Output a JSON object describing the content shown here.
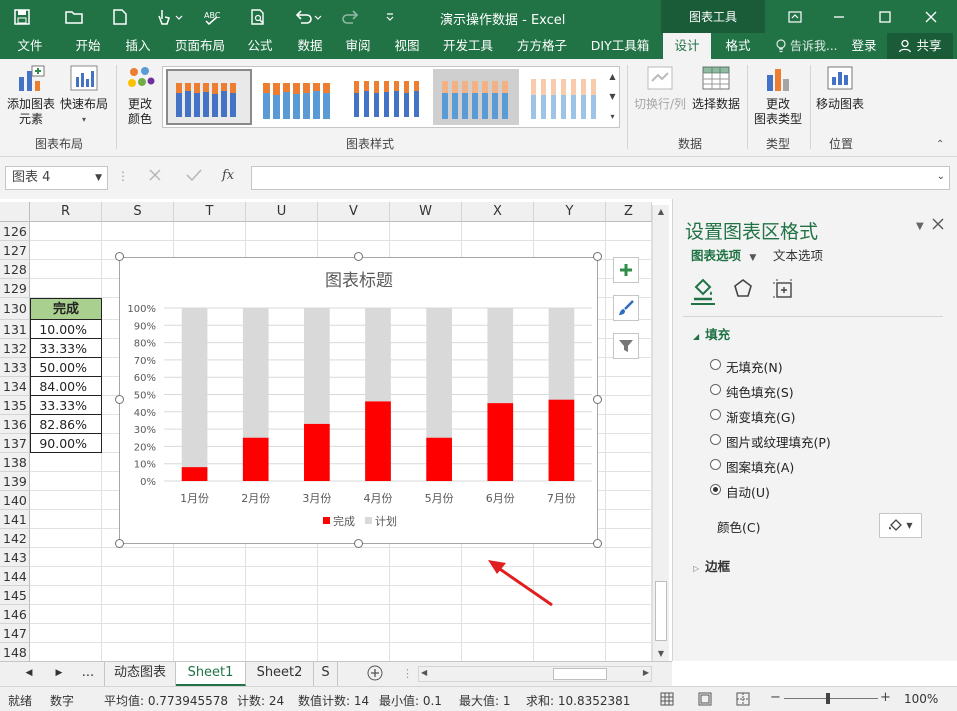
{
  "window": {
    "doc_title": "演示操作数据 - Excel",
    "context_tab_title": "图表工具"
  },
  "tabs": [
    "文件",
    "开始",
    "插入",
    "页面布局",
    "公式",
    "数据",
    "审阅",
    "视图",
    "开发工具",
    "方方格子",
    "DIY工具箱",
    "设计",
    "格式"
  ],
  "active_tab": "设计",
  "tell_me": "告诉我...",
  "login": "登录",
  "share": "共享",
  "ribbon": {
    "add_element": "添加图表\n元素",
    "quick_layout": "快速布局",
    "change_colors": "更改\n颜色",
    "group_layout": "图表布局",
    "group_styles": "图表样式",
    "switch_rowcol": "切换行/列",
    "select_data": "选择数据",
    "group_data": "数据",
    "change_type": "更改\n图表类型",
    "group_type": "类型",
    "move_chart": "移动图表",
    "group_location": "位置"
  },
  "formula": {
    "name_box": "图表 4",
    "fx": "fx"
  },
  "grid": {
    "columns": [
      "R",
      "S",
      "T",
      "U",
      "V",
      "W",
      "X",
      "Y",
      "Z"
    ],
    "rows": [
      "126",
      "127",
      "128",
      "129",
      "130",
      "131",
      "132",
      "133",
      "134",
      "135",
      "136",
      "137",
      "138",
      "139",
      "140",
      "141",
      "142",
      "143",
      "144",
      "145",
      "146",
      "147",
      "148"
    ],
    "table_header": "完成",
    "values": [
      "10.00%",
      "33.33%",
      "50.00%",
      "84.00%",
      "33.33%",
      "82.86%",
      "90.00%"
    ]
  },
  "chart_data": {
    "type": "bar",
    "title": "图表标题",
    "categories": [
      "1月份",
      "2月份",
      "3月份",
      "4月份",
      "5月份",
      "6月份",
      "7月份"
    ],
    "series": [
      {
        "name": "完成",
        "values": [
          8,
          25,
          33,
          46,
          25,
          45,
          47
        ],
        "color": "#ff0000"
      },
      {
        "name": "计划",
        "values": [
          100,
          100,
          100,
          100,
          100,
          100,
          100
        ],
        "color": "#d9d9d9"
      }
    ],
    "yticks": [
      "0%",
      "10%",
      "20%",
      "30%",
      "40%",
      "50%",
      "60%",
      "70%",
      "80%",
      "90%",
      "100%"
    ],
    "ylim": [
      0,
      100
    ],
    "grid": true,
    "legend": "bottom"
  },
  "pane": {
    "title": "设置图表区格式",
    "tab_chart_options": "图表选项",
    "tab_text_options": "文本选项",
    "section_fill": "填充",
    "fill_options": [
      "无填充(N)",
      "纯色填充(S)",
      "渐变填充(G)",
      "图片或纹理填充(P)",
      "图案填充(A)",
      "自动(U)"
    ],
    "selected_fill": "自动(U)",
    "color_label": "颜色(C)",
    "section_border": "边框"
  },
  "sheets": {
    "nav_more": "...",
    "tabs": [
      "动态图表",
      "Sheet1",
      "Sheet2",
      "S"
    ],
    "active": "Sheet1"
  },
  "status": {
    "ready": "就绪",
    "mode": "数字",
    "average": "平均值: 0.773945578",
    "count": "计数: 24",
    "numeric_count": "数值计数: 14",
    "min": "最小值: 0.1",
    "max": "最大值: 1",
    "sum": "求和: 10.8352381",
    "zoom": "100%"
  },
  "colors": {
    "excel_green": "#217346",
    "header_fill": "#a9d08e",
    "bar_done": "#ff0000",
    "bar_plan": "#d9d9d9"
  }
}
